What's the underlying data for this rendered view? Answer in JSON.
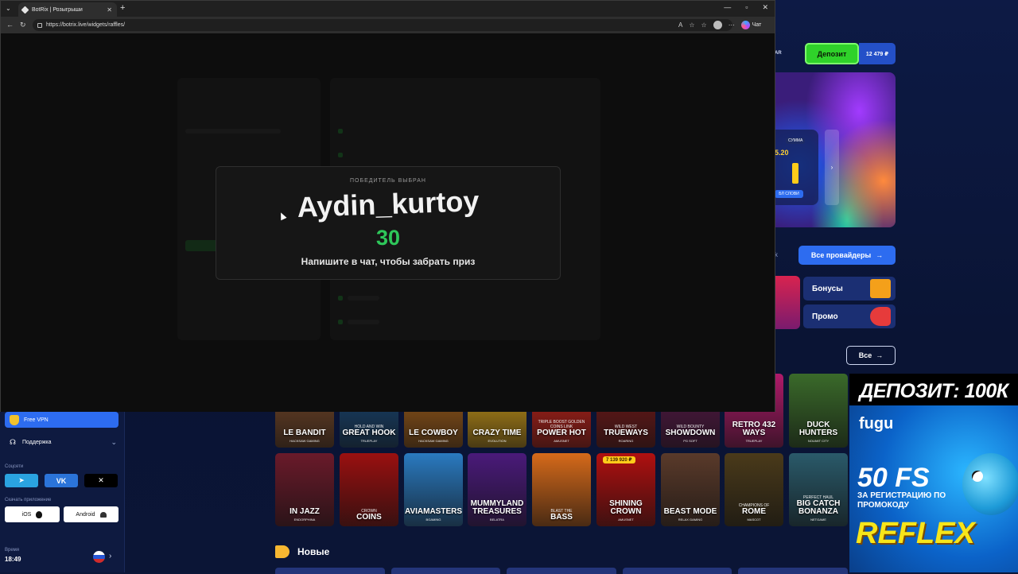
{
  "browser": {
    "tab_title": "BotRix | Розыгрыши",
    "url": "https://botrix.live/widgets/raffles/",
    "chat_label": "Чат"
  },
  "modal": {
    "label": "ПОБЕДИТЕЛЬ ВЫБРАН",
    "winner": "Aydin_kurtoy",
    "countdown": "30",
    "message": "Напишите в чат, чтобы забрать приз"
  },
  "site": {
    "ar_text": "AR",
    "deposit_label": "Депозит",
    "balance": "12 479 ₽",
    "banner_pill": "СУММА",
    "banner_value": "5.20",
    "banner_btn": "БЛ СЛОВИ",
    "providers_label": "Все провайдеры",
    "k_letter": "k",
    "side_tiles": [
      "Бонусы",
      "Промо"
    ],
    "all_label": "Все",
    "new_section": "Новые"
  },
  "sidebar": {
    "vpn_label": "Free VPN",
    "support_label": "Поддержка",
    "socials_label": "Соцсети",
    "download_label": "Скачать приложение",
    "ios_label": "iOS",
    "android_label": "Android",
    "time_label": "Время",
    "time_value": "18:49"
  },
  "games": [
    {
      "name": "LE BANDIT",
      "provider": "HACKSAW GAMING",
      "color": "#7a4a2a"
    },
    {
      "name": "GREAT HOOK",
      "sub": "HOLD AND WIN",
      "provider": "TRUEPLAY",
      "color": "#1a4a7a"
    },
    {
      "name": "LE COWBOY",
      "provider": "HACKSAW GAMING",
      "color": "#a8621a"
    },
    {
      "name": "CRAZY TIME",
      "provider": "EVOLUTION",
      "color": "#d6a21a"
    },
    {
      "name": "POWER HOT",
      "sub": "TRIPLE BOOST GOLDEN COINS LINK",
      "provider": "AMUSNET",
      "color": "#c9231a"
    },
    {
      "name": "TRUEWAYS",
      "sub": "WILD WEST",
      "provider": "ROARING",
      "color": "#7a1a1a"
    },
    {
      "name": "SHOWDOWN",
      "sub": "WILD BOUNTY",
      "provider": "PG SOFT",
      "color": "#5a1a4a"
    },
    {
      "name": "RETRO 432 WAYS",
      "provider": "TRUEPLAY",
      "color": "#b01a6a"
    },
    {
      "name": "DUCK HUNTERS",
      "provider": "NOLIMIT CITY",
      "color": "#3a6a2a"
    },
    {
      "name": "IN JAZZ",
      "provider": "ENDORPHINA",
      "color": "#6a1a2a"
    },
    {
      "name": "COINS",
      "sub": "CROWN",
      "provider": "",
      "color": "#9a1010"
    },
    {
      "name": "AVIAMASTERS",
      "provider": "BGAMING",
      "color": "#2a7ac0"
    },
    {
      "name": "MUMMYLAND TREASURES",
      "provider": "BELATRA",
      "color": "#4a1a7a"
    },
    {
      "name": "BASS",
      "sub": "BLAST THE",
      "provider": "",
      "color": "#d66a1a"
    },
    {
      "name": "SHINING CROWN",
      "badge": "7 139 920 ₽",
      "provider": "AMUSNET",
      "color": "#b01010"
    },
    {
      "name": "BEAST MODE",
      "provider": "RELAX GAMING",
      "color": "#5a3a2a"
    },
    {
      "name": "ROME",
      "sub": "CHAMPIONS OF",
      "provider": "MASCOT",
      "color": "#4a3a1a"
    },
    {
      "name": "BIG CATCH BONANZA",
      "sub": "PERFECT HAUL",
      "provider": "NETGAME",
      "color": "#2a5a6a"
    }
  ],
  "ad": {
    "headline": "ДЕПОЗИТ: 100К",
    "brand": "fugu",
    "fs": "50 FS",
    "subtitle": "ЗА РЕГИСТРАЦИЮ ПО ПРОМОКОДУ",
    "code": "REFLEX"
  },
  "colors": {
    "accent_green": "#2ec75a",
    "site_bg": "#0b1638",
    "button_blue": "#2d6cf0"
  }
}
